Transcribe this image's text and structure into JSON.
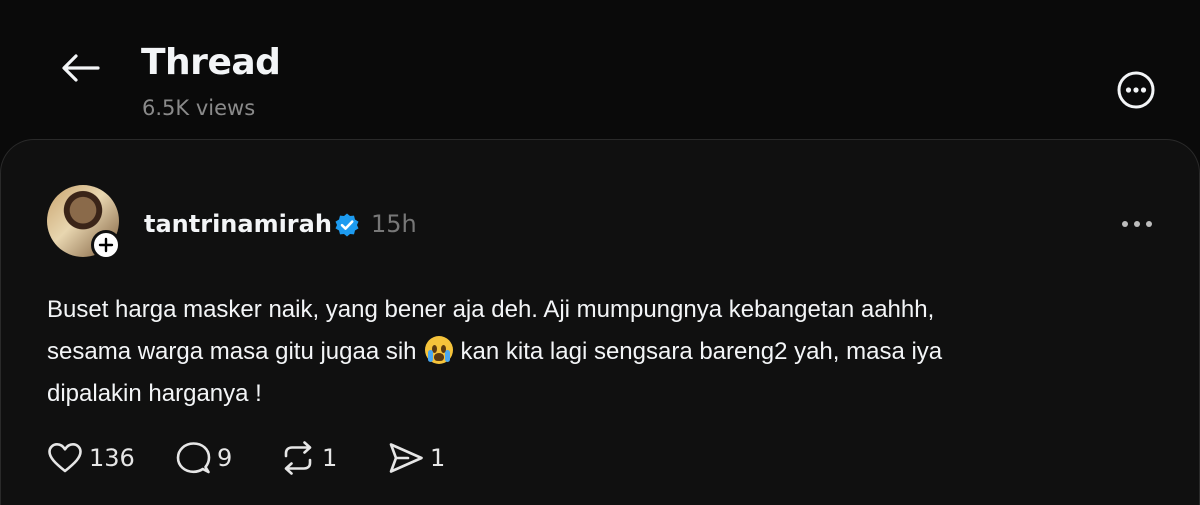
{
  "header": {
    "title": "Thread",
    "views": "6.5K views"
  },
  "post": {
    "username": "tantrinamirah",
    "timestamp": "15h",
    "text_line1": "Buset harga masker naik, yang bener aja deh. Aji mumpungnya kebangetan aahhh,",
    "text_line2a": "sesama warga masa gitu jugaa sih",
    "text_line2b": "kan kita lagi sengsara bareng2 yah, masa iya",
    "text_line3": "dipalakin harganya !",
    "emoji": "loudly-crying-face",
    "likes": "136",
    "replies": "9",
    "reposts": "1",
    "shares": "1"
  },
  "colors": {
    "background": "#0a0a0a",
    "card": "#101010",
    "verified": "#1d9bf0",
    "muted": "#777777"
  },
  "icons": {
    "back": "back-arrow-icon",
    "more": "more-circle-icon",
    "verified": "verified-badge-icon",
    "post_menu": "ellipsis-icon",
    "like": "heart-icon",
    "reply": "comment-icon",
    "repost": "repost-icon",
    "share": "send-icon",
    "follow": "plus-icon"
  }
}
